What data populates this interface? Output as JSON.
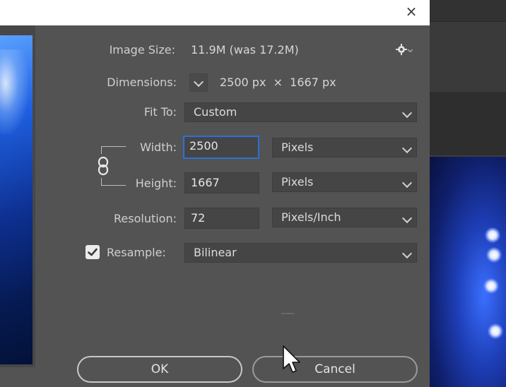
{
  "dialog": {
    "close_glyph": "×",
    "image_size": {
      "label": "Image Size:",
      "value": "11.9M (was 17.2M)"
    },
    "dimensions": {
      "label": "Dimensions:",
      "value": "2500 px  ×  1667 px"
    },
    "fit_to": {
      "label": "Fit To:",
      "selected": "Custom"
    },
    "width": {
      "label": "Width:",
      "value": "2500",
      "unit": "Pixels"
    },
    "height": {
      "label": "Height:",
      "value": "1667",
      "unit": "Pixels"
    },
    "resolution": {
      "label": "Resolution:",
      "value": "72",
      "unit": "Pixels/Inch"
    },
    "resample": {
      "label": "Resample:",
      "checked": true,
      "selected": "Bilinear"
    },
    "buttons": {
      "ok": "OK",
      "cancel": "Cancel"
    }
  },
  "icons": {
    "settings": "gear-icon",
    "close": "close-icon",
    "link": "chain-link-icon",
    "cursor": "mouse-pointer-icon"
  },
  "colors": {
    "dialog_bg": "#535353",
    "field_bg": "#454545",
    "focus_border": "#2f6fd6",
    "text": "#cfcfcf"
  }
}
